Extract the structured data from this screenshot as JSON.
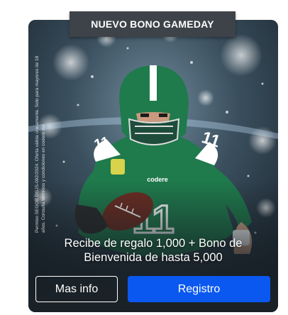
{
  "badge": {
    "text": "NUEVO BONO GAMEDAY"
  },
  "hero": {
    "jersey_number": "11",
    "sleeve_sponsor": "codere",
    "legal_text": "Permiso SEGOB DGJS-092/2024. Oferta válida únicamente. Solo para mayores de 18 años. Consulta términos y condiciones en codere.mx"
  },
  "promo": {
    "text": "Recibe de regalo 1,000 + Bono de Bienvenida de hasta 5,000"
  },
  "buttons": {
    "info_label": "Mas info",
    "register_label": "Registro"
  },
  "colors": {
    "register_button": "#0a58f0",
    "badge_bg": "#3d4348",
    "jersey_green": "#1f7a4c"
  }
}
